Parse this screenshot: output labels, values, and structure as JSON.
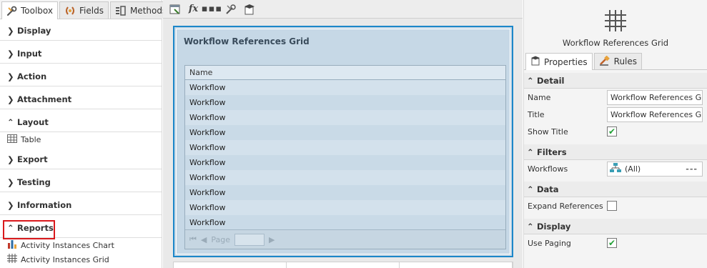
{
  "toolbox": {
    "tabs": [
      {
        "label": "Toolbox",
        "icon": "wrench-icon"
      },
      {
        "label": "Fields",
        "icon": "fields-icon"
      },
      {
        "label": "Methods",
        "icon": "methods-icon"
      }
    ],
    "categories": [
      {
        "label": "Display"
      },
      {
        "label": "Input"
      },
      {
        "label": "Action"
      },
      {
        "label": "Attachment"
      },
      {
        "label": "Layout",
        "items": [
          "Table"
        ]
      },
      {
        "label": "Export"
      },
      {
        "label": "Testing"
      },
      {
        "label": "Information"
      },
      {
        "label": "Reports",
        "items": [
          "Activity Instances Chart",
          "Activity Instances Grid"
        ]
      }
    ]
  },
  "canvas": {
    "toolbar_icons": [
      "add-view-icon",
      "formula-icon",
      "ellipsis-icon",
      "tools-icon",
      "cap-icon"
    ],
    "formula_glyph": "fx",
    "grid": {
      "title": "Workflow References Grid",
      "column": "Name",
      "rows": [
        "Workflow",
        "Workflow",
        "Workflow",
        "Workflow",
        "Workflow",
        "Workflow",
        "Workflow",
        "Workflow",
        "Workflow",
        "Workflow"
      ],
      "pager_label": "Page"
    }
  },
  "properties": {
    "header_title": "Workflow References Grid",
    "tabs": [
      {
        "label": "Properties"
      },
      {
        "label": "Rules"
      }
    ],
    "sections": {
      "detail": {
        "label": "Detail",
        "name_label": "Name",
        "name_value": "Workflow References Grid",
        "title_label": "Title",
        "title_value": "Workflow References Grid",
        "show_title_label": "Show Title",
        "show_title": true
      },
      "filters": {
        "label": "Filters",
        "workflows_label": "Workflows",
        "workflows_value": "(All)",
        "more": "---"
      },
      "data": {
        "label": "Data",
        "expand_label": "Expand References",
        "expand": false
      },
      "display": {
        "label": "Display",
        "use_paging_label": "Use Paging",
        "use_paging": true
      }
    }
  },
  "colors": {
    "accent_border": "#1c87c9",
    "highlight_red": "#d9191c",
    "check_green": "#22a036",
    "grid_bg": "#c6d8e6"
  }
}
